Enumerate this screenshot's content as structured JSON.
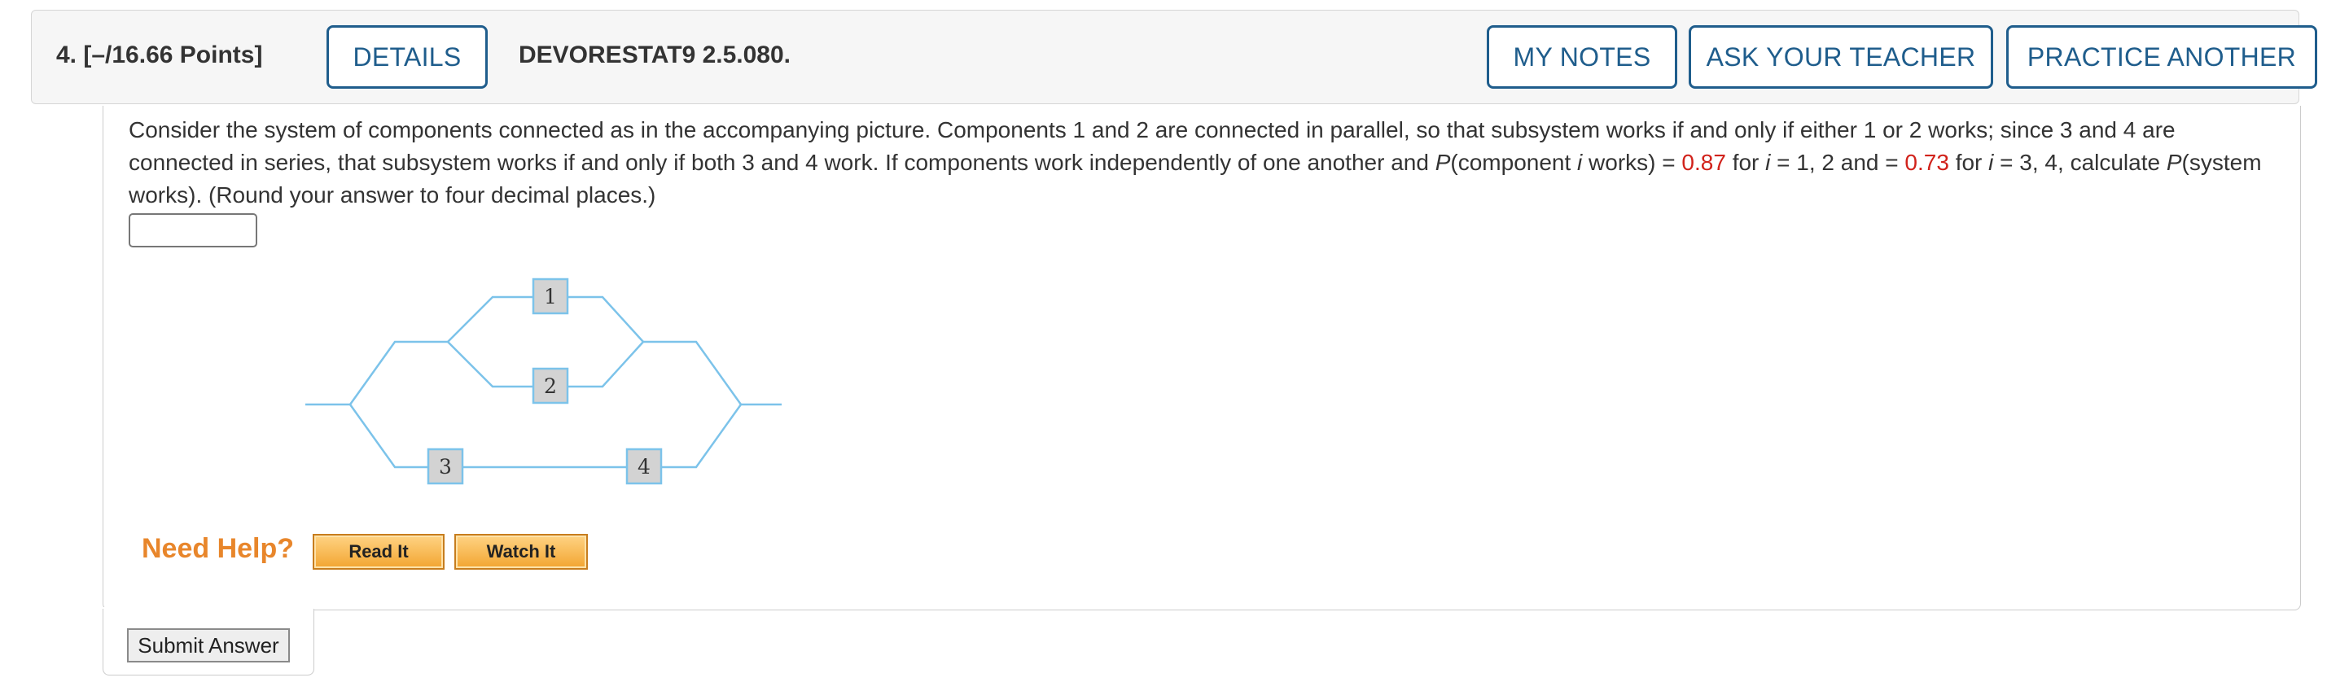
{
  "header": {
    "points": "4. [–/16.66 Points]",
    "details_label": "DETAILS",
    "problem_code": "DEVORESTAT9 2.5.080.",
    "my_notes_label": "MY NOTES",
    "ask_teacher_label": "ASK YOUR TEACHER",
    "practice_another_label": "PRACTICE ANOTHER"
  },
  "question": {
    "text_1": "Consider the system of components connected as in the accompanying picture. Components 1 and 2 are connected in parallel, so that subsystem works if and only if either 1 or 2 works; since 3 and 4 are connected in series, that subsystem works if and only if both 3 and 4 work. If components work independently of one another and ",
    "p_symbol": "P",
    "text_2": "(component ",
    "i_symbol": "i",
    "text_3": " works) = ",
    "value_1": "0.87",
    "text_4": " for ",
    "text_5": " = 1, 2 and = ",
    "value_2": "0.73",
    "text_6": " = 3, 4, calculate ",
    "text_7": "(system works). (Round your answer to four decimal places.)",
    "answer_value": ""
  },
  "diagram": {
    "components": [
      "1",
      "2",
      "3",
      "4"
    ]
  },
  "help": {
    "need_help_label": "Need Help?",
    "read_it_label": "Read It",
    "watch_it_label": "Watch It"
  },
  "submit_label": "Submit Answer",
  "colors": {
    "accent": "#1f5d8c",
    "highlight_value": "#d1221b",
    "need_help": "#e8862b",
    "diagram_line": "#7cc3ea"
  }
}
